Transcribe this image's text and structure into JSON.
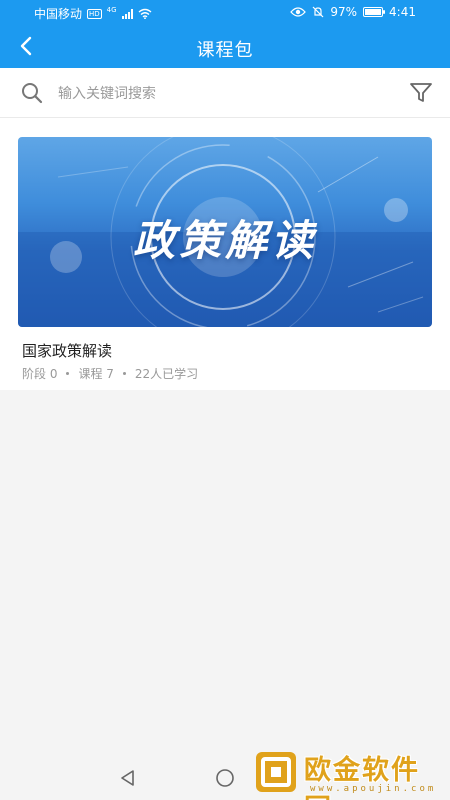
{
  "status_bar": {
    "carrier": "中国移动",
    "hd": "HD",
    "network": "4G",
    "battery_percent_text": "97%",
    "battery_level": 0.97,
    "time": "4:41"
  },
  "header": {
    "title": "课程包",
    "back_icon": "chevron-left-icon",
    "background": "#1c9af0"
  },
  "search": {
    "placeholder": "输入关键词搜索",
    "value": "",
    "icon": "search-icon",
    "filter_icon": "filter-icon"
  },
  "courses": [
    {
      "banner_text": "政策解读",
      "title": "国家政策解读",
      "meta": {
        "stages": "阶段 0",
        "lessons": "课程 7",
        "learners": "22人已学习"
      }
    }
  ],
  "nav": {
    "back_icon": "triangle-back-icon",
    "home_icon": "circle-home-icon"
  },
  "watermark": {
    "text": "欧金软件园",
    "url": "www.apoujin.com"
  },
  "colors": {
    "accent": "#1c9af0",
    "page_background": "#f4f4f4",
    "watermark": "#e0a21b"
  }
}
